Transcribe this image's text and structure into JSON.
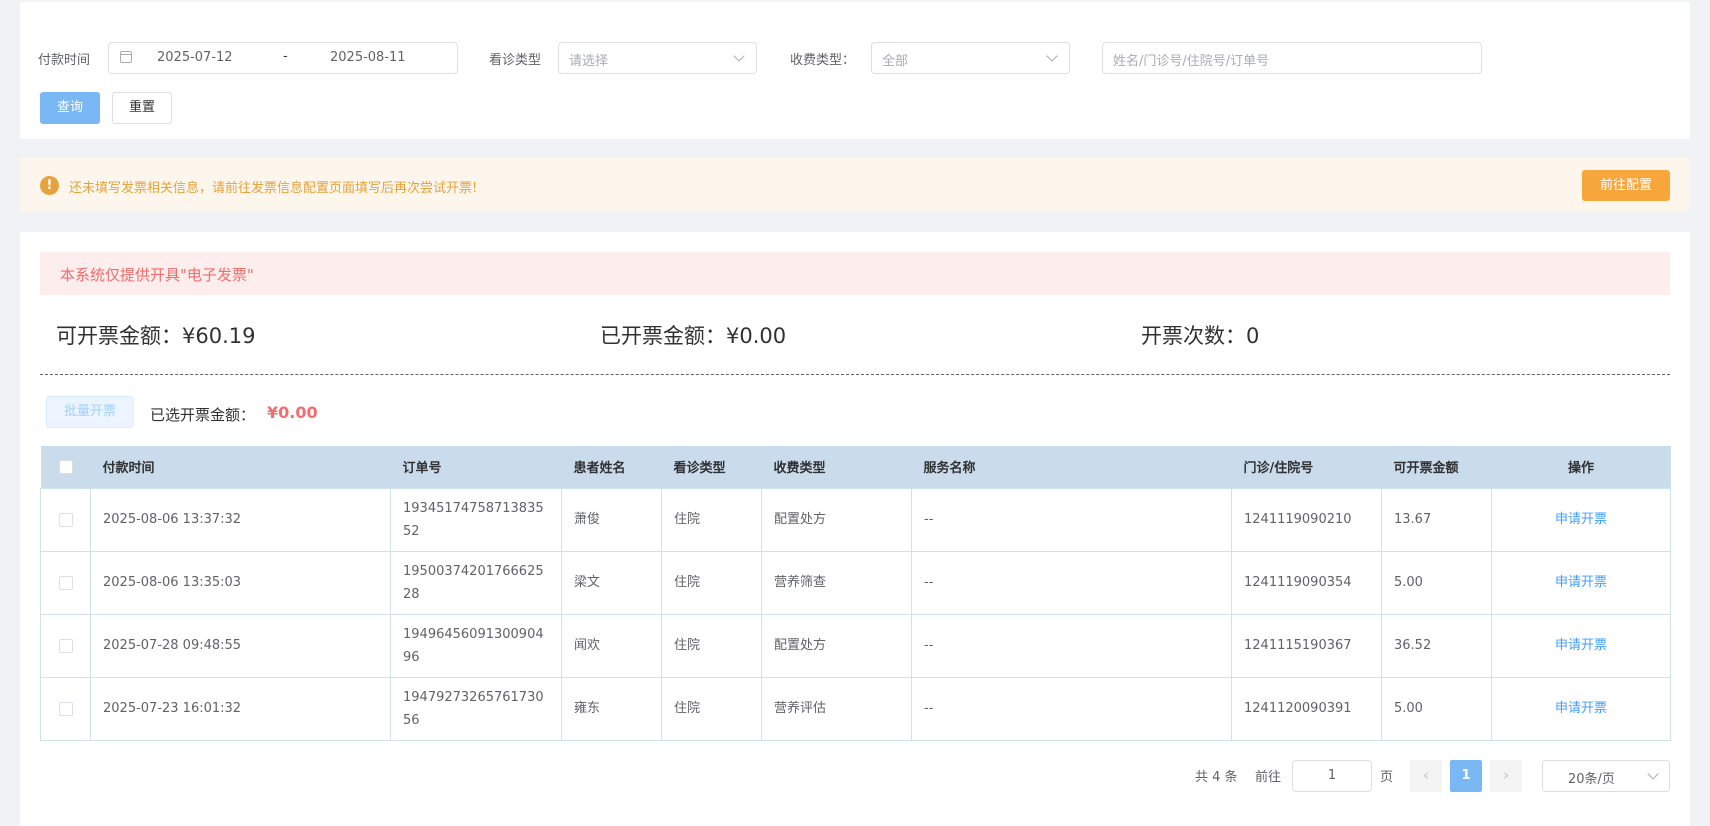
{
  "filters": {
    "pay_time_label": "付款时间",
    "date_start": "2025-07-12",
    "date_sep": "-",
    "date_end": "2025-08-11",
    "visit_type_label": "看诊类型",
    "visit_type_placeholder": "请选择",
    "fee_type_label": "收费类型：",
    "fee_type_value": "全部",
    "search_placeholder": "姓名/门诊号/住院号/订单号",
    "query_btn": "查询",
    "reset_btn": "重置"
  },
  "warning": {
    "icon": "!",
    "text": "还未填写发票相关信息，请前往发票信息配置页面填写后再次尝试开票!",
    "button": "前往配置",
    "color": "#e6a23c"
  },
  "notice": {
    "text": "本系统仅提供开具\"电子发票\"",
    "color": "#f56c6c"
  },
  "stats": {
    "available": "可开票金额：¥60.19",
    "issued": "已开票金额：¥0.00",
    "count": "开票次数：0"
  },
  "batch": {
    "button": "批量开票",
    "selected_label": "已选开票金额：",
    "selected_value": "¥0.00"
  },
  "table": {
    "headers": {
      "pay_time": "付款时间",
      "order_no": "订单号",
      "patient": "患者姓名",
      "visit_type": "看诊类型",
      "fee_type": "收费类型",
      "service": "服务名称",
      "record_no": "门诊/住院号",
      "amount": "可开票金额",
      "action": "操作"
    },
    "rows": [
      {
        "pay_time": "2025-08-06 13:37:32",
        "order_no": "1934517475871383552",
        "patient": "萧俊",
        "visit_type": "住院",
        "fee_type": "配置处方",
        "service": "--",
        "record_no": "1241119090210",
        "amount": "13.67",
        "action": "申请开票"
      },
      {
        "pay_time": "2025-08-06 13:35:03",
        "order_no": "1950037420176662528",
        "patient": "梁文",
        "visit_type": "住院",
        "fee_type": "营养筛查",
        "service": "--",
        "record_no": "1241119090354",
        "amount": "5.00",
        "action": "申请开票"
      },
      {
        "pay_time": "2025-07-28 09:48:55",
        "order_no": "1949645609130090496",
        "patient": "闻欢",
        "visit_type": "住院",
        "fee_type": "配置处方",
        "service": "--",
        "record_no": "1241115190367",
        "amount": "36.52",
        "action": "申请开票"
      },
      {
        "pay_time": "2025-07-23 16:01:32",
        "order_no": "1947927326576173056",
        "patient": "雍东",
        "visit_type": "住院",
        "fee_type": "营养评估",
        "service": "--",
        "record_no": "1241120090391",
        "amount": "5.00",
        "action": "申请开票"
      }
    ]
  },
  "pagination": {
    "total": "共 4 条",
    "goto": "前往",
    "page_input": "1",
    "page_unit": "页",
    "prev": "‹",
    "current": "1",
    "next": "›",
    "page_size": "20条/页"
  }
}
